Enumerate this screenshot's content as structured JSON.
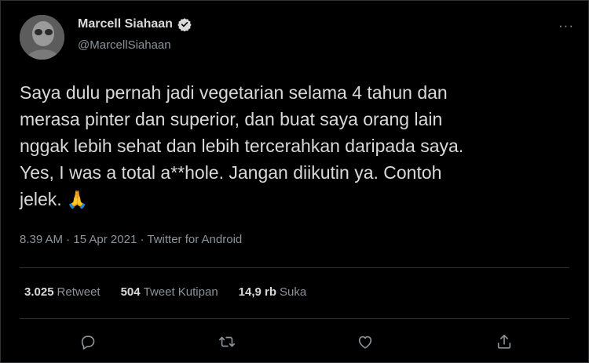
{
  "author": {
    "name": "Marcell Siahaan",
    "handle": "@MarcellSiahaan",
    "verified_icon": "verified-badge-icon"
  },
  "tweet": {
    "text": "Saya dulu pernah jadi vegetarian selama 4 tahun dan\nmerasa pinter dan superior, dan buat saya orang lain\nnggak lebih sehat dan lebih tercerahkan daripada saya.\nYes, I was a total a**hole. Jangan diikutin ya. Contoh\njelek.",
    "emoji": "🙏",
    "time": "8.39 AM",
    "sep1": " · ",
    "date": "15 Apr 2021",
    "sep2": " · ",
    "source": "Twitter for Android"
  },
  "stats": {
    "retweets": {
      "value": "3.025",
      "label": "Retweet"
    },
    "quotes": {
      "value": "504",
      "label": "Tweet Kutipan"
    },
    "likes": {
      "value": "14,9 rb",
      "label": "Suka"
    }
  },
  "actions": {
    "reply_icon": "reply-icon",
    "retweet_icon": "retweet-icon",
    "like_icon": "heart-icon",
    "share_icon": "share-icon",
    "more_label": "···"
  },
  "colors": {
    "background": "#000000",
    "text": "#d9d9d9",
    "muted": "#8b949a",
    "divider": "#2f3336"
  }
}
